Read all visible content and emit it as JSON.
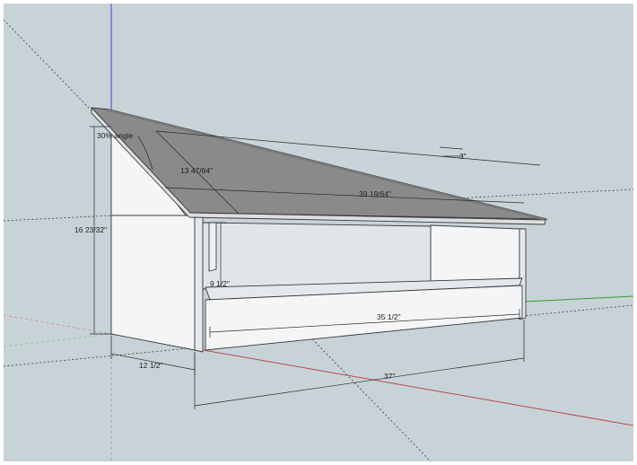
{
  "viewport": {
    "background": "#c8d3d7",
    "axis_colors": {
      "red": "#b84a4a",
      "green": "#3a9a3a",
      "blue": "#4646c8"
    }
  },
  "model": {
    "roof_color": "#8a8a8a",
    "wall_color": "#f4f5f6",
    "dimensions": {
      "angle": "30% angle",
      "roof_overhang": "3\"",
      "roof_depth": "13 47/64\"",
      "roof_length": "39 19/64\"",
      "height": "16 23/32\"",
      "tray_height": "9 1/2\"",
      "tray_length": "35 1/2\"",
      "depth": "12 1/2\"",
      "length": "37\""
    }
  }
}
